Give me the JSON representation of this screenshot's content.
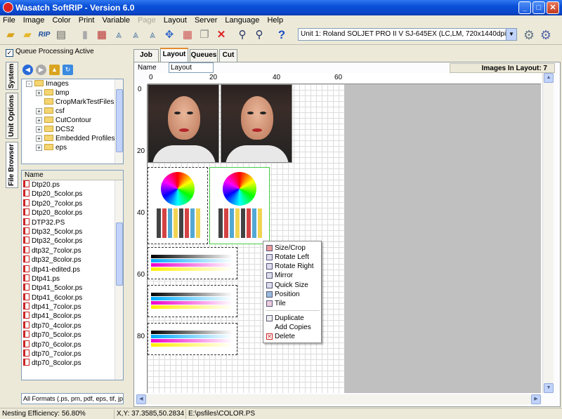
{
  "window": {
    "title": "Wasatch SoftRIP  - Version 6.0"
  },
  "menu": [
    "File",
    "Image",
    "Color",
    "Print",
    "Variable",
    "Page",
    "Layout",
    "Server",
    "Language",
    "Help"
  ],
  "menu_disabled": [
    "Page"
  ],
  "toolbar": {
    "icons": [
      "open-folder-icon",
      "folder-icon",
      "rip-icon",
      "print-icon",
      "pause-icon",
      "delete-job-icon",
      "rotate-icon",
      "mirror-icon",
      "flip-icon",
      "position-icon",
      "grid-icon",
      "copy-icon",
      "close-icon",
      "zoom-in-icon",
      "zoom-out-icon",
      "help-icon"
    ],
    "rip_label": "RIP",
    "help_label": "?"
  },
  "unit_select": {
    "value": "Unit 1: Roland  SOLJET PRO II V SJ-645EX (LC,LM, 720x1440dpi)"
  },
  "left": {
    "queue_processing": "Queue Processing Active",
    "vtabs": [
      "System",
      "Unit Options",
      "File Browser"
    ],
    "tree": [
      {
        "label": "Images",
        "level": 0,
        "expander": "-"
      },
      {
        "label": "bmp",
        "level": 1,
        "expander": "+"
      },
      {
        "label": "CropMarkTestFiles",
        "level": 1,
        "expander": ""
      },
      {
        "label": "csf",
        "level": 1,
        "expander": "+"
      },
      {
        "label": "CutContour",
        "level": 1,
        "expander": "+"
      },
      {
        "label": "DCS2",
        "level": 1,
        "expander": "+"
      },
      {
        "label": "Embedded Profiles",
        "level": 1,
        "expander": "+"
      },
      {
        "label": "eps",
        "level": 1,
        "expander": "+"
      }
    ],
    "file_header": "Name",
    "files": [
      "Dtp20.ps",
      "Dtp20_5color.ps",
      "Dtp20_7color.ps",
      "Dtp20_8color.ps",
      "DTP32.PS",
      "Dtp32_5color.ps",
      "Dtp32_6color.ps",
      "dtp32_7color.ps",
      "dtp32_8color.ps",
      "dtp41-edited.ps",
      "Dtp41.ps",
      "Dtp41_5color.ps",
      "Dtp41_6color.ps",
      "dtp41_7color.ps",
      "dtp41_8color.ps",
      "dtp70_4color.ps",
      "dtp70_5color.ps",
      "dtp70_6color.ps",
      "dtp70_7color.ps",
      "dtp70_8color.ps"
    ],
    "format_filter": "All Formats (.ps, prn, pdf, eps, tif, jp"
  },
  "tabs": [
    "Job",
    "Layout",
    "Queues",
    "Cut"
  ],
  "active_tab": "Layout",
  "layout": {
    "name_label": "Name",
    "name_value": "Layout",
    "images_count": "Images In Layout: 7",
    "ruler_h": [
      "0",
      "20",
      "40",
      "60"
    ],
    "ruler_v": [
      "0",
      "20",
      "40",
      "60",
      "80"
    ]
  },
  "context_menu": [
    "Size/Crop",
    "Rotate Left",
    "Rotate Right",
    "Mirror",
    "Quick Size",
    "Position",
    "Tile",
    "Duplicate",
    "Add Copies",
    "Delete"
  ],
  "status": {
    "nesting": "Nesting Efficiency: 56.80%",
    "xy": "X,Y: 37.3585,50.2834",
    "file": "E:\\psfiles\\COLOR.PS"
  }
}
